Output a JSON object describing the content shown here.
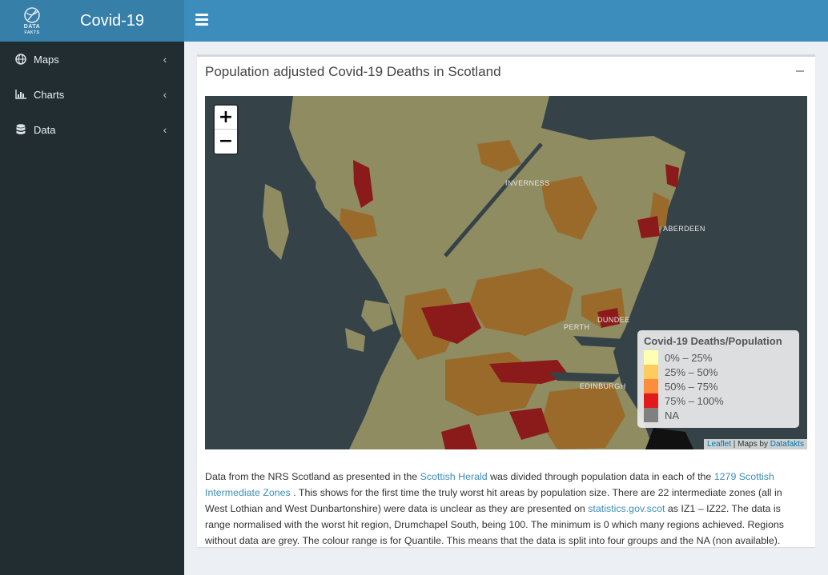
{
  "header": {
    "logo_text_1": "DATA",
    "logo_text_2": "FAKTS",
    "title": "Covid-19"
  },
  "sidebar": {
    "items": [
      {
        "label": "Maps",
        "icon": "globe-icon"
      },
      {
        "label": "Charts",
        "icon": "bar-chart-icon"
      },
      {
        "label": "Data",
        "icon": "database-icon"
      }
    ]
  },
  "box": {
    "title": "Population adjusted Covid-19 Deaths in Scotland"
  },
  "map": {
    "zoom_in": "+",
    "zoom_out": "−",
    "cities": {
      "inverness": "INVERNESS",
      "aberdeen": "ABERDEEN",
      "dundee": "DUNDEE",
      "perth": "PERTH",
      "edinburgh": "EDINBURGH"
    },
    "legend": {
      "title": "Covid-19 Deaths/Population",
      "items": [
        {
          "label": "0% – 25%",
          "color": "#ffffb2"
        },
        {
          "label": "25% – 50%",
          "color": "#fecc5c"
        },
        {
          "label": "50% – 75%",
          "color": "#fd8d3c"
        },
        {
          "label": "75% – 100%",
          "color": "#e31a1c"
        },
        {
          "label": "NA",
          "color": "#808080"
        }
      ]
    },
    "attribution": {
      "leaflet": "Leaflet",
      "sep": " | Maps by ",
      "datafakts": "Datafakts"
    }
  },
  "description": {
    "t1": "Data from the NRS Scotland as presented in the ",
    "l1": "Scottish Herald",
    "t2": " was divided through population data in each of the ",
    "l2": "1279 Scottish Intermediate Zones",
    "t3": " . This shows for the first time the truly worst hit areas by population size. There are 22 intermediate zones (all in West Lothian and West Dunbartonshire) were data is unclear as they are presented on ",
    "l3": "statistics.gov.scot",
    "t4": " as IZ1 – IZ22. The data is range normalised with the worst hit region, Drumchapel South, being 100. The minimum is 0 which many regions achieved. Regions without data are grey. The colour range is for Quantile. This means that the data is split into four groups and the NA (non available)."
  },
  "colors": {
    "header_dark": "#367fa9",
    "header": "#3c8dbc",
    "sidebar": "#222d32",
    "content_bg": "#ecf0f5",
    "link": "#3c8dbc"
  }
}
